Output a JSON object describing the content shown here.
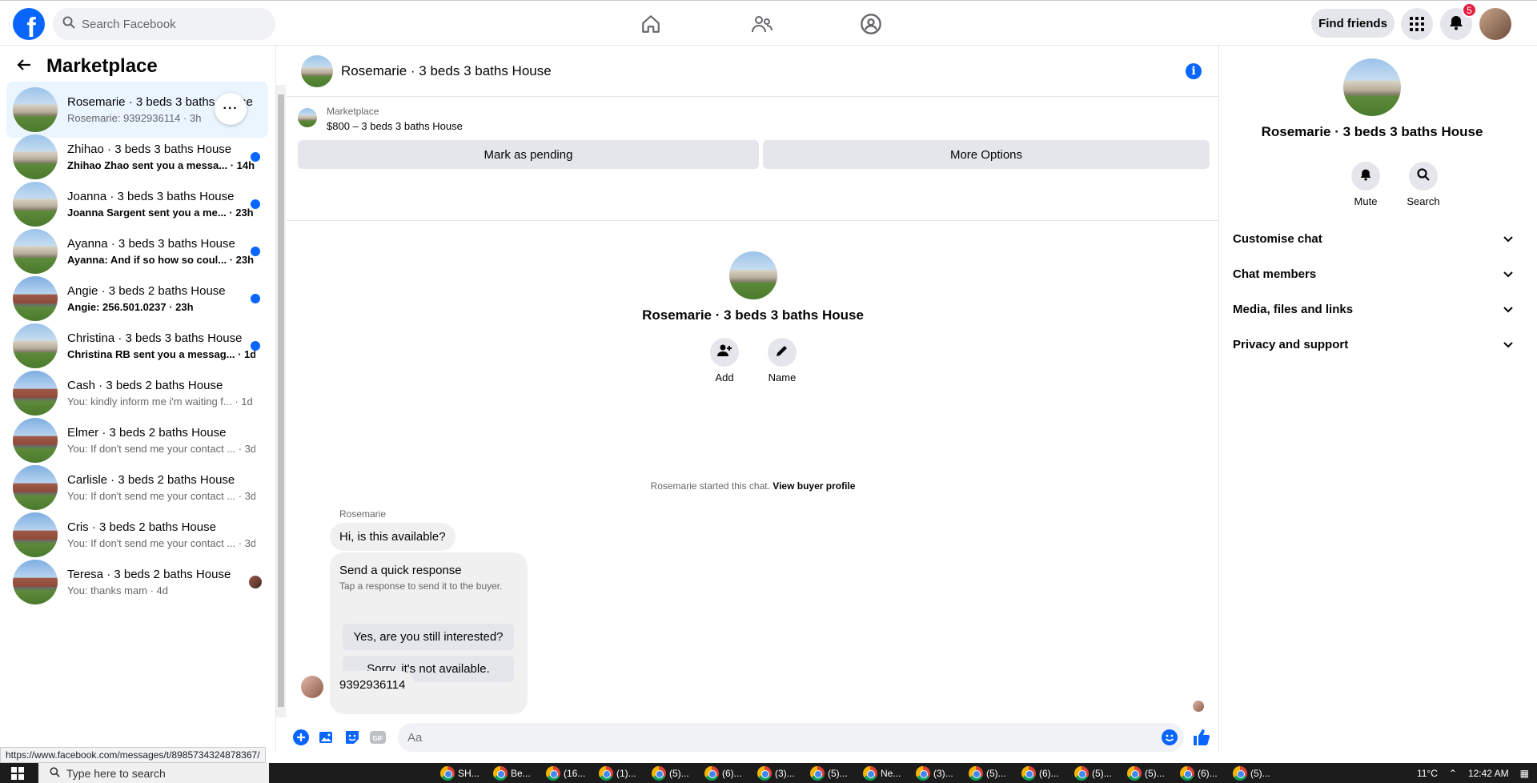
{
  "header": {
    "logo_letter": "f",
    "search_placeholder": "Search Facebook",
    "find_friends": "Find friends",
    "notif_count": "5"
  },
  "sidebar": {
    "title": "Marketplace",
    "conversations": [
      {
        "title": "Rosemarie · 3 beds 3 baths House",
        "preview": "Rosemarie: 9392936114 · 3h",
        "unread": false,
        "active": true,
        "img": "house"
      },
      {
        "title": "Zhihao · 3 beds 3 baths House",
        "preview": "Zhihao Zhao sent you a messa... · 14h",
        "unread": true,
        "img": "house"
      },
      {
        "title": "Joanna · 3 beds 3 baths House",
        "preview": "Joanna Sargent sent you a me... · 23h",
        "unread": true,
        "img": "house"
      },
      {
        "title": "Ayanna · 3 beds 3 baths House",
        "preview": "Ayanna: And if so how so coul... · 23h",
        "unread": true,
        "img": "house"
      },
      {
        "title": "Angie · 3 beds 2 baths House",
        "preview": "Angie: 256.501.0237 · 23h",
        "unread": true,
        "img": "house2"
      },
      {
        "title": "Christina · 3 beds 3 baths House",
        "preview": "Christina RB sent you a messag... · 1d",
        "unread": true,
        "img": "house"
      },
      {
        "title": "Cash · 3 beds 2 baths House",
        "preview": "You: kindly inform me i'm waiting f... · 1d",
        "unread": false,
        "img": "house2"
      },
      {
        "title": "Elmer · 3 beds 2 baths House",
        "preview": "You: If don't send me your contact ... · 3d",
        "unread": false,
        "img": "house2"
      },
      {
        "title": "Carlisle · 3 beds 2 baths House",
        "preview": "You: If don't send me your contact ... · 3d",
        "unread": false,
        "img": "house2"
      },
      {
        "title": "Cris · 3 beds 2 baths House",
        "preview": "You: If don't send me your contact ... · 3d",
        "unread": false,
        "img": "house2"
      },
      {
        "title": "Teresa · 3 beds 2 baths House",
        "preview": "You: thanks mam · 4d",
        "unread": false,
        "img": "house2",
        "seen_avatar": true
      }
    ]
  },
  "chat": {
    "header_name": "Rosemarie · 3 beds 3 baths House",
    "marketplace_label": "Marketplace",
    "listing": "$800 – 3 beds 3 baths House",
    "mark_pending": "Mark as pending",
    "more_options": "More Options",
    "profile_name": "Rosemarie · 3 beds 3 baths House",
    "add_label": "Add",
    "name_label": "Name",
    "started_text": "Rosemarie started this chat.",
    "view_buyer": "View buyer profile",
    "sender": "Rosemarie",
    "msg1": "Hi, is this available?",
    "quick_title": "Send a quick response",
    "quick_sub": "Tap a response to send it to the buyer.",
    "quick_1": "Yes, are you still interested?",
    "quick_2": "Sorry, it's not available.",
    "msg2": "9392936114",
    "composer_placeholder": "Aa"
  },
  "details": {
    "name": "Rosemarie · 3 beds 3 baths House",
    "mute": "Mute",
    "search": "Search",
    "sections": [
      "Customise chat",
      "Chat members",
      "Media, files and links",
      "Privacy and support"
    ]
  },
  "status_url": "https://www.facebook.com/messages/t/8985734324878367/",
  "taskbar": {
    "search_placeholder": "Type here to search",
    "apps": [
      "SH...",
      "Be...",
      "(16...",
      "(1)...",
      "(5)...",
      "(6)...",
      "(3)...",
      "(5)...",
      "Ne...",
      "(3)...",
      "(5)...",
      "(6)...",
      "(5)...",
      "(5)...",
      "(6)...",
      "(5)..."
    ],
    "temp": "11°C",
    "time": "12:42 AM"
  },
  "colors": {
    "accent": "#0866ff",
    "badge": "#e41e3f"
  }
}
